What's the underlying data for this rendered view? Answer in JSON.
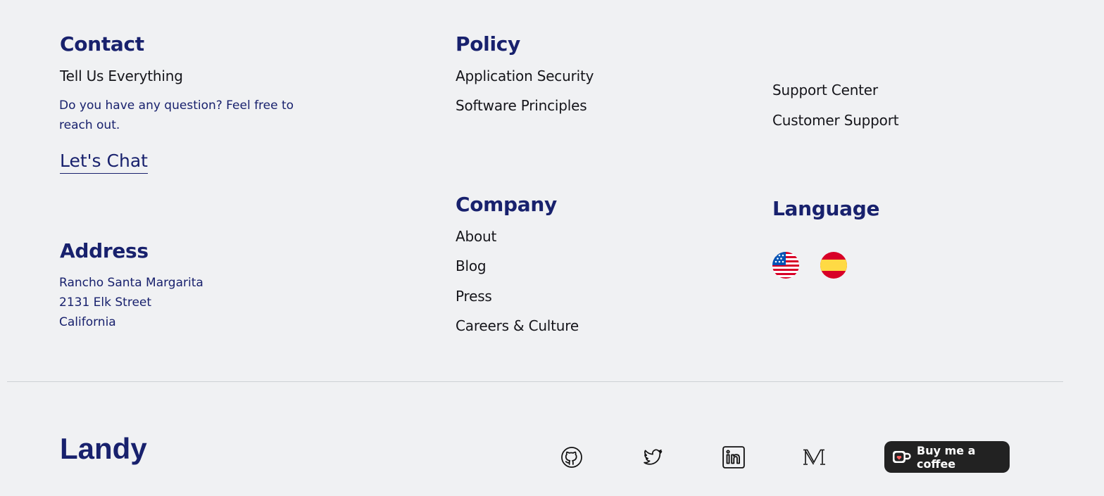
{
  "contact": {
    "title": "Contact",
    "subtitle": "Tell Us Everything",
    "text": "Do you have any question? Feel free to reach out.",
    "cta": "Let's Chat"
  },
  "address": {
    "title": "Address",
    "lines": [
      "Rancho Santa Margarita",
      "2131 Elk Street",
      "California"
    ]
  },
  "policy": {
    "title": "Policy",
    "links": [
      "Application Security",
      "Software Principles"
    ]
  },
  "support": {
    "links": [
      "Support Center",
      "Customer Support"
    ]
  },
  "company": {
    "title": "Company",
    "links": [
      "About",
      "Blog",
      "Press",
      "Careers & Culture"
    ]
  },
  "language": {
    "title": "Language",
    "flags": [
      "us-flag-icon",
      "spain-flag-icon"
    ]
  },
  "footer": {
    "logo": "Landy",
    "social": [
      "github-icon",
      "twitter-icon",
      "linkedin-icon",
      "medium-icon"
    ],
    "coffee_button": "Buy me a coffee"
  },
  "colors": {
    "heading": "#18216d",
    "background": "#f0f1f3",
    "button_bg": "#222222",
    "coffee_accent": "#ff5f5f"
  }
}
